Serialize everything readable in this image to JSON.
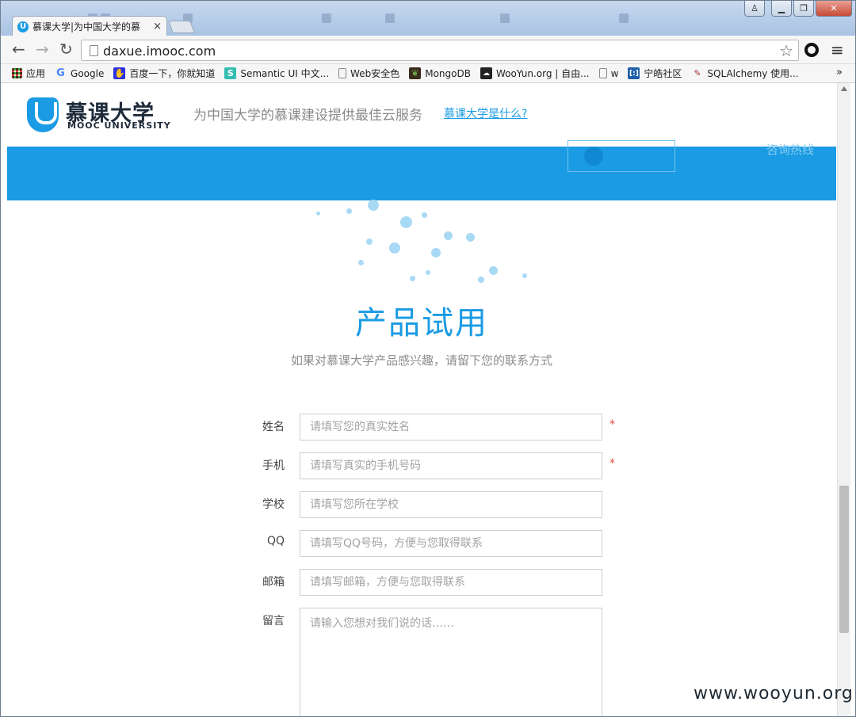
{
  "browser": {
    "tab": {
      "favicon": "U",
      "title": "慕课大学|为中国大学的慕",
      "close": "×"
    },
    "window_buttons": {
      "user": "♙",
      "minimize": "▁",
      "maximize": "❐",
      "close": "✕"
    },
    "address_bar": {
      "url": "daxue.imooc.com"
    },
    "nav": {
      "back": "←",
      "forward": "→",
      "reload": "↻",
      "star": "☆",
      "menu": "≡"
    },
    "bookmarks": [
      {
        "label": "应用",
        "icon": "apps-grid-icon"
      },
      {
        "label": "Google",
        "icon": "google-icon"
      },
      {
        "label": "百度一下，你就知道",
        "icon": "baidu-paw-icon"
      },
      {
        "label": "Semantic UI 中文...",
        "icon": "semantic-s-icon"
      },
      {
        "label": "Web安全色",
        "icon": "page-icon"
      },
      {
        "label": "MongoDB",
        "icon": "mongodb-leaf-icon"
      },
      {
        "label": "WooYun.org | 自由...",
        "icon": "wooyun-icon"
      },
      {
        "label": "w",
        "icon": "page-icon"
      },
      {
        "label": "宁皓社区",
        "icon": "ninghao-icon"
      },
      {
        "label": "SQLAlchemy 使用...",
        "icon": "sqlalchemy-icon"
      }
    ],
    "bookmarks_more": "»"
  },
  "site": {
    "logo_cn": "慕课大学",
    "logo_en": "MOOC UNIVERSITY",
    "slogan": "为中国大学的慕课建设提供最佳云服务",
    "what_link": "慕课大学是什么?",
    "hotline_label": "咨询热线"
  },
  "trial": {
    "title": "产品试用",
    "subtitle": "如果对慕课大学产品感兴趣，请留下您的联系方式"
  },
  "form": {
    "fields": [
      {
        "label": "姓名",
        "placeholder": "请填写您的真实姓名",
        "required": "*"
      },
      {
        "label": "手机",
        "placeholder": "请填写真实的手机号码",
        "required": "*"
      },
      {
        "label": "学校",
        "placeholder": "请填写您所在学校"
      },
      {
        "label": "QQ",
        "placeholder": "请填写QQ号码，方便与您取得联系"
      },
      {
        "label": "邮箱",
        "placeholder": "请填写邮箱，方便与您取得联系"
      }
    ],
    "message": {
      "label": "留言",
      "placeholder": "请输入您想对我们说的话……"
    }
  },
  "watermark": "www.wooyun.org",
  "colors": {
    "brand": "#1a9be3",
    "required": "#e24b3c"
  }
}
